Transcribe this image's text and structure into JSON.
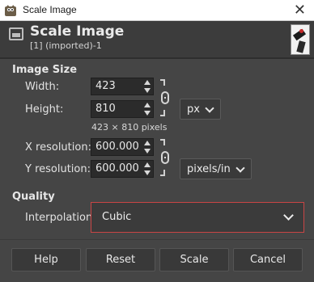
{
  "window": {
    "title": "Scale Image",
    "close_glyph": "✕",
    "icon": "gimp-wilber-icon"
  },
  "header": {
    "title": "Scale Image",
    "subtitle": "[1] (imported)-1",
    "icon": "image-icon",
    "thumbnail": "image-thumbnail"
  },
  "image_size": {
    "section_label": "Image Size",
    "width_label": "Width:",
    "width_value": "423",
    "height_label": "Height:",
    "height_value": "810",
    "unit": "px",
    "pixels_info": "423 × 810 pixels",
    "x_res_label": "X resolution:",
    "x_res_value": "600.000",
    "y_res_label": "Y resolution:",
    "y_res_value": "600.000",
    "res_unit": "pixels/in"
  },
  "quality": {
    "section_label": "Quality",
    "interp_label": "Interpolation:",
    "interp_value": "Cubic"
  },
  "buttons": {
    "help": "Help",
    "reset": "Reset",
    "scale": "Scale",
    "cancel": "Cancel"
  },
  "colors": {
    "background": "#454545",
    "focus_border": "#c94545"
  }
}
